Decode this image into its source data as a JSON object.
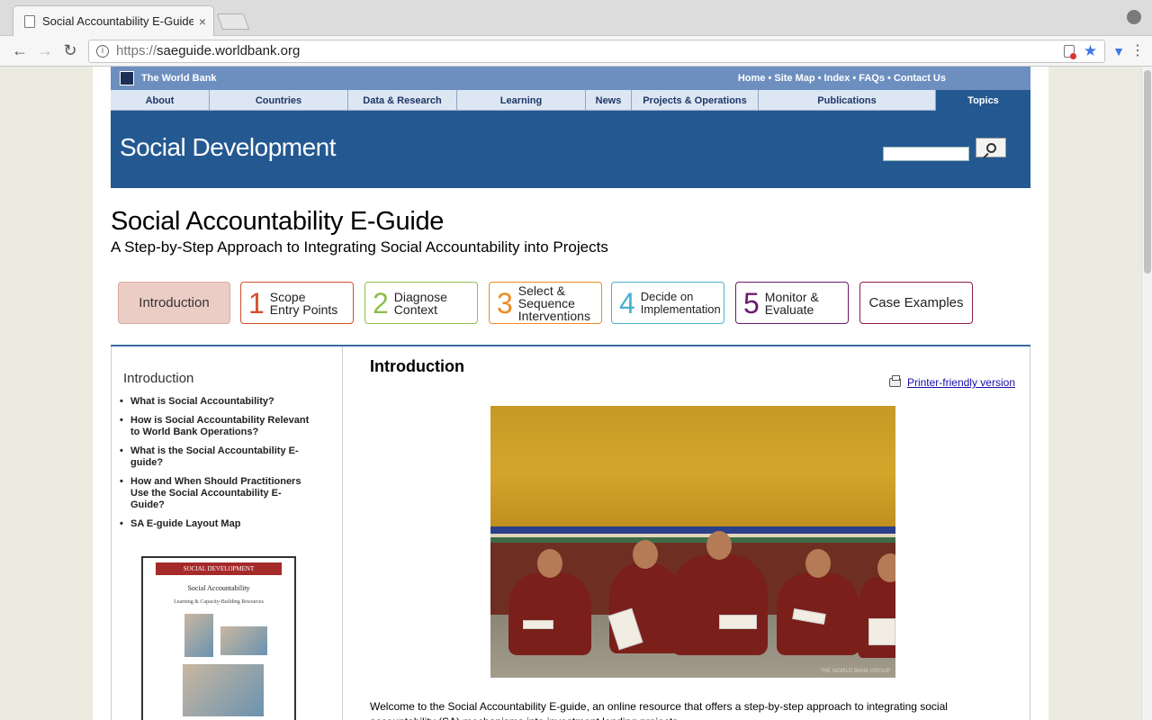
{
  "browser": {
    "tab_title": "Social Accountability E-Guide",
    "tab_close": "×",
    "url_scheme": "https://",
    "url_host": "saeguide.worldbank.org"
  },
  "icons": {
    "back": "back-arrow-icon",
    "forward": "forward-arrow-icon",
    "reload": "reload-icon",
    "bookmark": "star-icon",
    "search": "magnifier-icon",
    "printer": "printer-icon"
  },
  "header": {
    "brand": "The World Bank",
    "top_links": "Home • Site Map • Index • FAQs • Contact Us",
    "nav": [
      "About",
      "Countries",
      "Data & Research",
      "Learning",
      "News",
      "Projects & Operations",
      "Publications",
      "Topics"
    ],
    "active_nav": "Topics",
    "section_title": "Social Development"
  },
  "guide": {
    "title": "Social Accountability E-Guide",
    "subtitle": "A Step-by-Step Approach to Integrating Social Accountability into Projects"
  },
  "steps": [
    {
      "label": "Introduction"
    },
    {
      "num": "1",
      "line1": "Scope",
      "line2": "Entry Points",
      "color": "#d4502a"
    },
    {
      "num": "2",
      "line1": "Diagnose",
      "line2": "Context",
      "color": "#8cbf4a"
    },
    {
      "num": "3",
      "line1": "Select &",
      "line2": "Sequence",
      "line3": "Interventions",
      "color": "#ef8a21"
    },
    {
      "num": "4",
      "line1": "Decide on",
      "line2": "Implementation",
      "color": "#4aaed1"
    },
    {
      "num": "5",
      "line1": "Monitor &",
      "line2": "Evaluate",
      "color": "#6a1b6e"
    },
    {
      "label": "Case Examples",
      "color": "#8e1c48"
    }
  ],
  "sidebar": {
    "heading": "Introduction",
    "items": [
      "What is Social Accountability?",
      "How is Social Accountability Relevant to World Bank Operations?",
      "What is the Social Accountability E-guide?",
      "How and When Should Practitioners Use the Social Accountability E-Guide?",
      "SA E-guide Layout Map"
    ],
    "book": {
      "header": "SOCIAL DEVELOPMENT",
      "title": "Social Accountability",
      "subtitle": "Learning & Capacity-Building Resources"
    }
  },
  "main": {
    "heading": "Introduction",
    "printer_link": "Printer-friendly version",
    "photo_watermark": "THE WORLD BANK GROUP",
    "intro_text": "Welcome to the Social Accountability E-guide, an online resource that offers a step-by-step approach to integrating social accountability (SA) mechanisms into investment lending projects."
  }
}
